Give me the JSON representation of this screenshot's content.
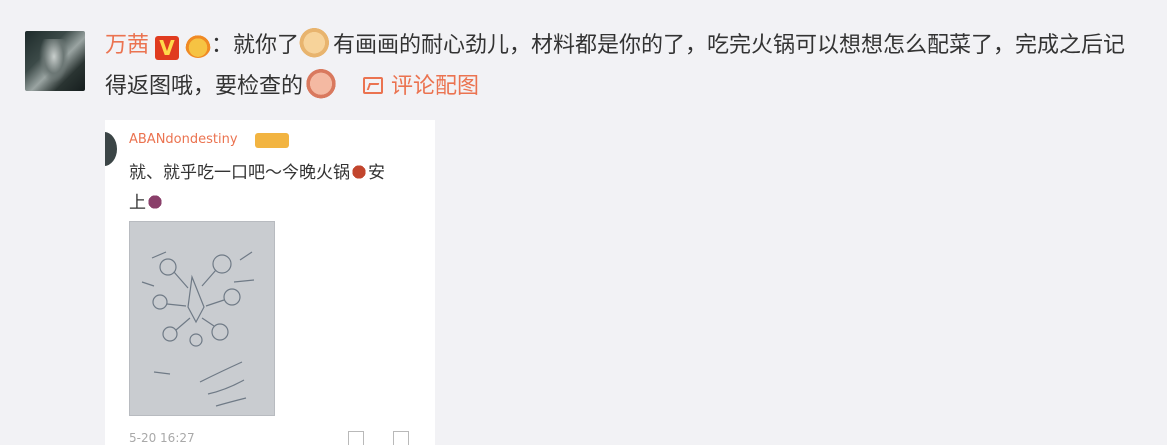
{
  "comment": {
    "username": "万茜",
    "v_badge": "V",
    "text_part1": "：就你了",
    "text_part2": "有画画的耐心劲儿，材料都是你的了，吃完火锅可以想想怎么配菜了，完成之后记得返图哦，要检查的",
    "pic_link_label": "评论配图",
    "icons": [
      "crown-emoji-icon",
      "ok-hand-emoji-icon",
      "face-emoji-icon",
      "image-icon"
    ]
  },
  "screenshot": {
    "username": "ABANdondestiny",
    "text_part1": "就、就乎吃一口吧～今晚火锅",
    "text_part2": "安",
    "text_part3": "上",
    "timestamp": "5-20 16:27",
    "icons": [
      "hotpot-emoji-icon",
      "girl-emoji-icon",
      "share-icon",
      "comment-icon"
    ]
  },
  "colors": {
    "background": "#f2f2f5",
    "accent": "#eb7350",
    "text": "#333333"
  }
}
